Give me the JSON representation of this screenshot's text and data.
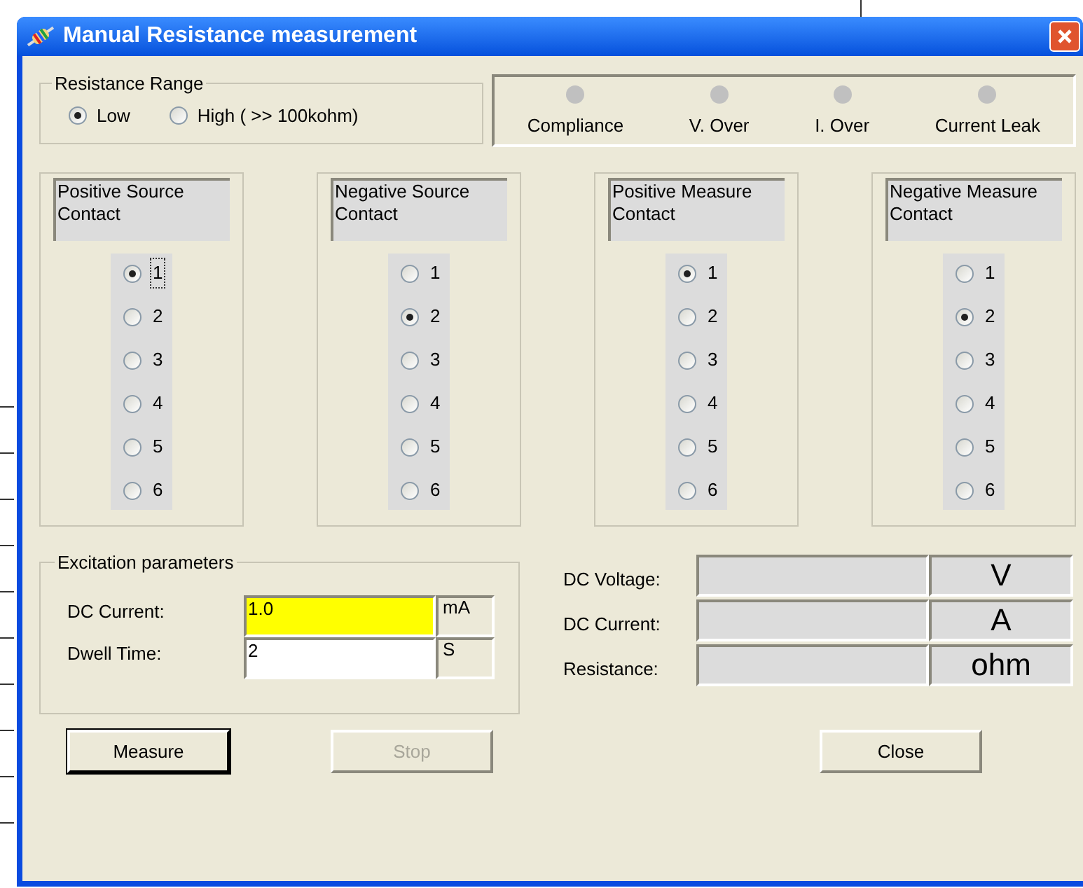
{
  "window": {
    "title": "Manual Resistance measurement"
  },
  "resistance_range": {
    "title": "Resistance Range",
    "options": [
      {
        "label": "Low",
        "selected": true
      },
      {
        "label": "High ( >> 100kohm)",
        "selected": false
      }
    ]
  },
  "indicators": [
    {
      "label": "Compliance",
      "lit": false
    },
    {
      "label": "V. Over",
      "lit": false
    },
    {
      "label": "I. Over",
      "lit": false
    },
    {
      "label": "Current Leak",
      "lit": false
    }
  ],
  "contact_groups": [
    {
      "title": "Positive Source Contact",
      "options": [
        {
          "label": "1",
          "selected": true,
          "focused": true
        },
        {
          "label": "2",
          "selected": false,
          "focused": false
        },
        {
          "label": "3",
          "selected": false,
          "focused": false
        },
        {
          "label": "4",
          "selected": false,
          "focused": false
        },
        {
          "label": "5",
          "selected": false,
          "focused": false
        },
        {
          "label": "6",
          "selected": false,
          "focused": false
        }
      ]
    },
    {
      "title": "Negative Source Contact",
      "options": [
        {
          "label": "1",
          "selected": false,
          "focused": false
        },
        {
          "label": "2",
          "selected": true,
          "focused": false
        },
        {
          "label": "3",
          "selected": false,
          "focused": false
        },
        {
          "label": "4",
          "selected": false,
          "focused": false
        },
        {
          "label": "5",
          "selected": false,
          "focused": false
        },
        {
          "label": "6",
          "selected": false,
          "focused": false
        }
      ]
    },
    {
      "title": "Positive Measure Contact",
      "options": [
        {
          "label": "1",
          "selected": true,
          "focused": false
        },
        {
          "label": "2",
          "selected": false,
          "focused": false
        },
        {
          "label": "3",
          "selected": false,
          "focused": false
        },
        {
          "label": "4",
          "selected": false,
          "focused": false
        },
        {
          "label": "5",
          "selected": false,
          "focused": false
        },
        {
          "label": "6",
          "selected": false,
          "focused": false
        }
      ]
    },
    {
      "title": "Negative Measure Contact",
      "options": [
        {
          "label": "1",
          "selected": false,
          "focused": false
        },
        {
          "label": "2",
          "selected": true,
          "focused": false
        },
        {
          "label": "3",
          "selected": false,
          "focused": false
        },
        {
          "label": "4",
          "selected": false,
          "focused": false
        },
        {
          "label": "5",
          "selected": false,
          "focused": false
        },
        {
          "label": "6",
          "selected": false,
          "focused": false
        }
      ]
    }
  ],
  "excitation": {
    "title": "Excitation parameters",
    "fields": [
      {
        "label": "DC Current:",
        "value": "1.0",
        "unit": "mA",
        "highlighted": true
      },
      {
        "label": "Dwell Time:",
        "value": "2",
        "unit": "S",
        "highlighted": false
      }
    ]
  },
  "readouts": [
    {
      "label": "DC Voltage:",
      "unit": "V"
    },
    {
      "label": "DC Current:",
      "unit": "A"
    },
    {
      "label": "Resistance:",
      "unit": "ohm"
    }
  ],
  "buttons": [
    {
      "label": "Measure",
      "disabled": false,
      "default": true
    },
    {
      "label": "Stop",
      "disabled": true,
      "default": false
    },
    {
      "label": "Close",
      "disabled": false,
      "default": false
    }
  ]
}
